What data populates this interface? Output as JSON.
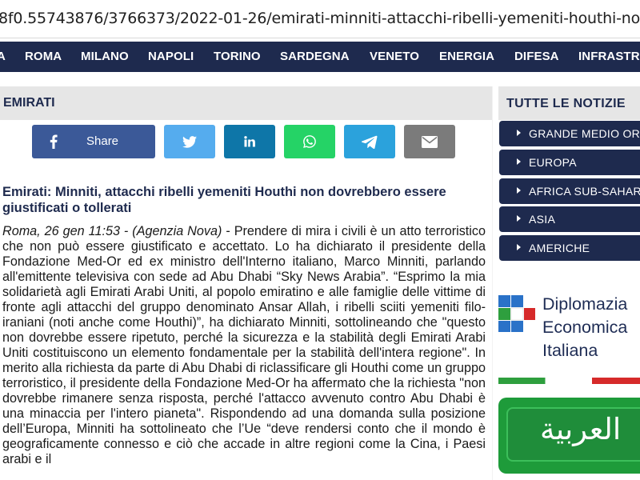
{
  "browser": {
    "url": "8f0.55743876/3766373/2022-01-26/emirati-minniti-attacchi-ribelli-yemeniti-houthi-non-dovrebbero-essere"
  },
  "nav": {
    "items": [
      {
        "label": "A"
      },
      {
        "label": "ROMA"
      },
      {
        "label": "MILANO"
      },
      {
        "label": "NAPOLI"
      },
      {
        "label": "TORINO"
      },
      {
        "label": "SARDEGNA"
      },
      {
        "label": "VENETO"
      },
      {
        "label": "ENERGIA"
      },
      {
        "label": "DIFESA"
      },
      {
        "label": "INFRASTR"
      }
    ]
  },
  "section": {
    "title": "EMIRATI"
  },
  "share": {
    "facebook_label": "Share"
  },
  "article": {
    "headline": "Emirati: Minniti, attacchi ribelli yemeniti Houthi non dovrebbero essere giustificati o tollerati",
    "dateline": "Roma, 26 gen 11:53 - (Agenzia Nova)",
    "body": " - Prendere di mira i civili è un atto terroristico che non può essere giustificato e accettato. Lo ha dichiarato il presidente della Fondazione Med-Or ed ex ministro dell'Interno italiano, Marco Minniti, parlando all'emittente televisiva con sede ad Abu Dhabi “Sky News Arabia”. “Esprimo la mia solidarietà agli Emirati Arabi Uniti, al popolo emiratino e alle famiglie delle vittime di fronte agli attacchi del gruppo denominato Ansar Allah, i ribelli sciiti yemeniti filo-iraniani (noti anche come Houthi)”, ha dichiarato Minniti, sottolineando che \"questo non dovrebbe essere ripetuto, perché la sicurezza e la stabilità degli Emirati Arabi Uniti costituiscono un elemento fondamentale per la stabilità dell'intera regione\". In merito alla richiesta da parte di Abu Dhabi di riclassificare gli Houthi come un gruppo terroristico, il presidente della Fondazione Med-Or ha affermato che la richiesta \"non dovrebbe rimanere senza risposta, perché l'attacco avvenuto contro Abu Dhabi è una minaccia per l'intero pianeta\". Rispondendo ad una domanda sulla posizione dell’Europa, Minniti ha sottolineato che l’Ue “deve rendersi conto che il mondo è geograficamente connesso e ciò che accade in altre regioni come la Cina, i Paesi arabi e il"
  },
  "sidebar": {
    "title": "TUTTE LE NOTIZIE",
    "categories": [
      {
        "label": "GRANDE MEDIO ORIENTE"
      },
      {
        "label": "EUROPA"
      },
      {
        "label": "AFRICA SUB-SAHARIANA"
      },
      {
        "label": "ASIA"
      },
      {
        "label": "AMERICHE"
      }
    ],
    "promo": {
      "line1": "Diplomazia",
      "line2": "Economica",
      "line3": "Italiana"
    },
    "arabic_banner": "العربية"
  },
  "colors": {
    "nav_bg": "#1e2a4e",
    "facebook": "#3b5998",
    "twitter": "#55acee",
    "linkedin": "#0e76a8",
    "whatsapp": "#25d366",
    "telegram": "#2ba2dc",
    "email": "#7b7b7b",
    "arabic_green": "#1e9b3a"
  }
}
